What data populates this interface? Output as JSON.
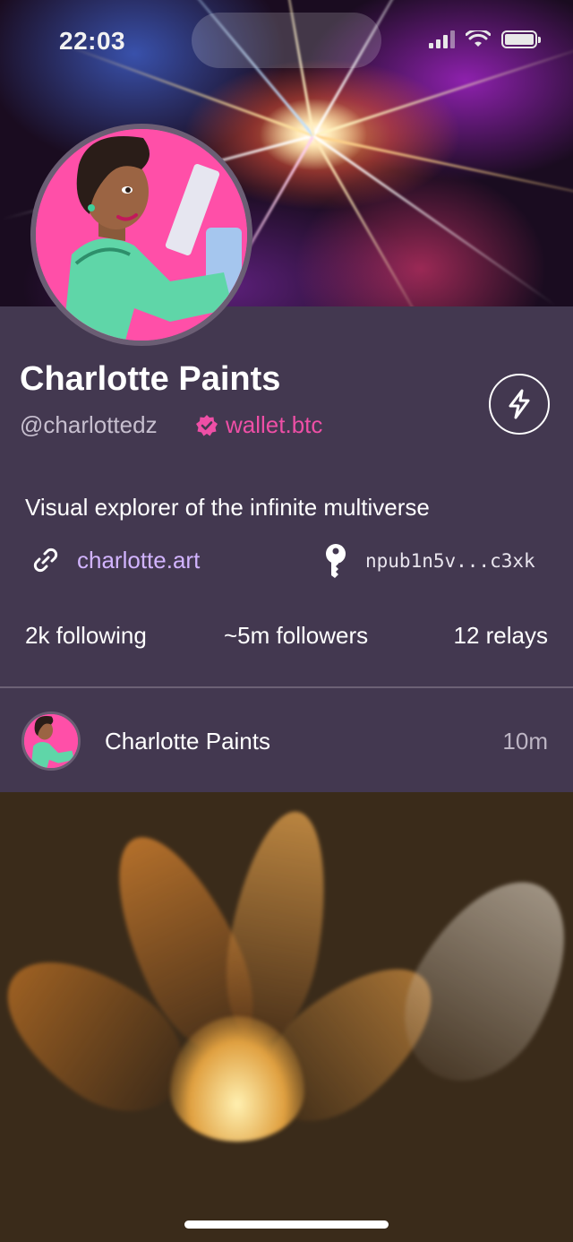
{
  "status_bar": {
    "time": "22:03",
    "signal_icon": "signal-icon",
    "wifi_icon": "wifi-icon",
    "battery_icon": "battery-icon"
  },
  "profile": {
    "name": "Charlotte Paints",
    "handle": "@charlottedz",
    "nip05": "wallet.btc",
    "bio": "Visual explorer of the infinite multiverse",
    "website": "charlotte.art",
    "npub": "npub1n5v...c3xk",
    "zap_icon": "lightning-icon"
  },
  "stats": {
    "following": "2k following",
    "followers": "~5m followers",
    "relays": "12 relays"
  },
  "post": {
    "author": "Charlotte Paints",
    "time": "10m"
  },
  "colors": {
    "background": "#433850",
    "accent_pink": "#ee4fa6",
    "link_purple": "#d2b4ff",
    "muted_text": "#c7bfcf"
  }
}
